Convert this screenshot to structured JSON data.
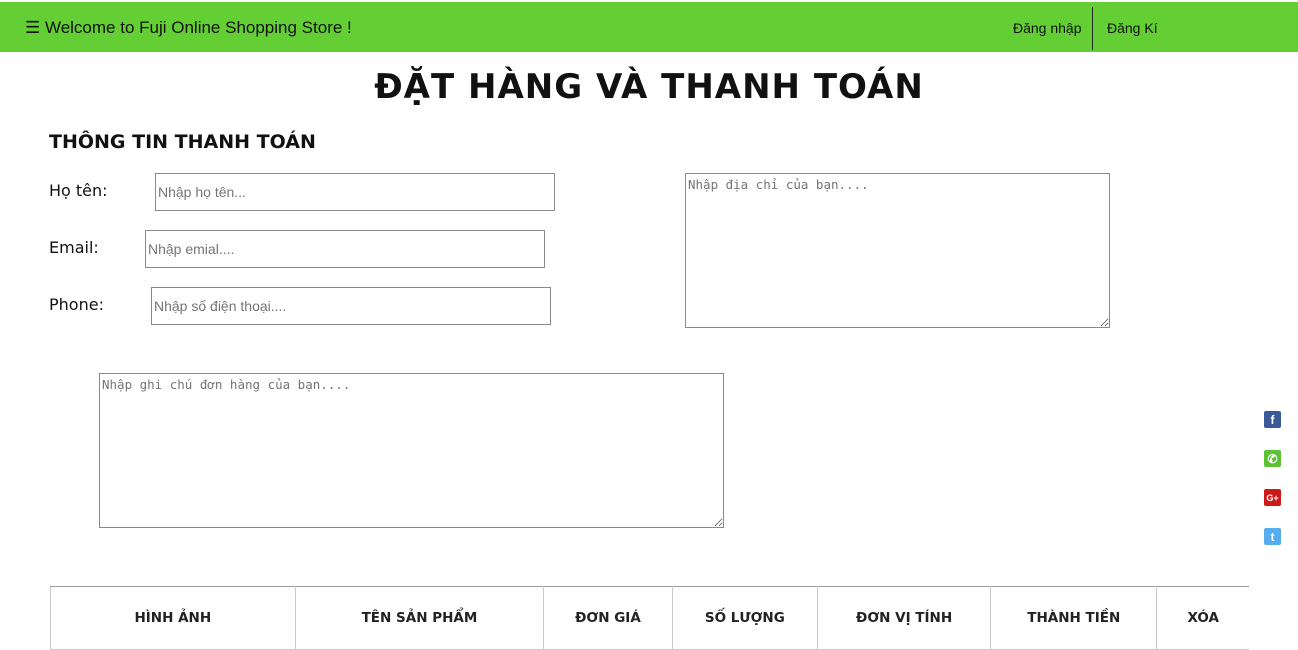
{
  "header": {
    "brand": "☰ Welcome to Fuji Online Shopping Store !",
    "login_label": "Đăng nhập",
    "register_label": "Đăng Kí",
    "bg_color": "#63cf35"
  },
  "page_title": "ĐẶT HÀNG VÀ THANH TOÁN",
  "billing": {
    "section_title": "THÔNG TIN THANH TOÁN",
    "name_label": "Họ tên:",
    "name_placeholder": "Nhập họ tên...",
    "email_label": "Email:",
    "email_placeholder": "Nhập emial....",
    "phone_label": "Phone:",
    "phone_placeholder": "Nhập số điện thoại....",
    "address_placeholder": "Nhập địa chỉ của bạn....",
    "note_placeholder": "Nhập ghi chú đơn hàng của bạn...."
  },
  "social": [
    {
      "icon": "facebook-icon",
      "glyph": "f",
      "color": "#3b5998"
    },
    {
      "icon": "phone-icon",
      "glyph": "✆",
      "color": "#5bc236"
    },
    {
      "icon": "google-plus-icon",
      "glyph": "G+",
      "color": "#cc1a1a"
    },
    {
      "icon": "twitter-icon",
      "glyph": "t",
      "color": "#55acee"
    }
  ],
  "cart_table": {
    "columns": [
      "HÌNH ẢNH",
      "TÊN SẢN PHẨM",
      "ĐƠN GIÁ",
      "SỐ LƯỢNG",
      "ĐƠN VỊ TÍNH",
      "THÀNH TIỀN",
      "XÓA"
    ]
  }
}
